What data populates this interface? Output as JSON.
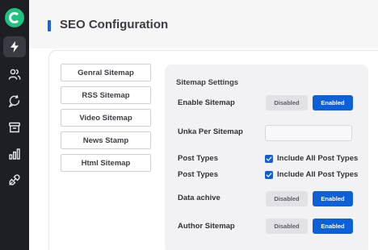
{
  "page": {
    "title": "SEO Configuration"
  },
  "sidebar": {
    "icons": [
      "lightning-icon",
      "users-icon",
      "chat-refresh-icon",
      "archive-icon",
      "bar-chart-icon",
      "plug-icon"
    ]
  },
  "tabs": [
    {
      "label": "Genral Sitemap"
    },
    {
      "label": "RSS Sitemap"
    },
    {
      "label": "Video Sitemap"
    },
    {
      "label": "News Stamp"
    },
    {
      "label": "Html Sitemap"
    }
  ],
  "settings": {
    "title": "Sitemap Settings",
    "enable_sitemap": {
      "label": "Enable Sitemap",
      "off_label": "Disabled",
      "on_label": "Enabled",
      "value": "Enabled"
    },
    "unka_per_sitemap": {
      "label": "Unka Per Sitemap",
      "value": ""
    },
    "post_types_1": {
      "label": "Post Types",
      "checkbox_label": "Include All Post Types",
      "checked": true
    },
    "post_types_2": {
      "label": "Post Types",
      "checkbox_label": "Include All Post Types",
      "checked": true
    },
    "data_achive": {
      "label": "Data achive",
      "off_label": "Disabled",
      "on_label": "Enabled",
      "value": "Enabled"
    },
    "author_sitemap": {
      "label": "Author Sitemap",
      "off_label": "Disabled",
      "on_label": "Enabled",
      "value": "Enabled"
    }
  },
  "colors": {
    "accent": "#0e60d8",
    "brand": "#1fc27e",
    "rail": "#1e1f24"
  }
}
